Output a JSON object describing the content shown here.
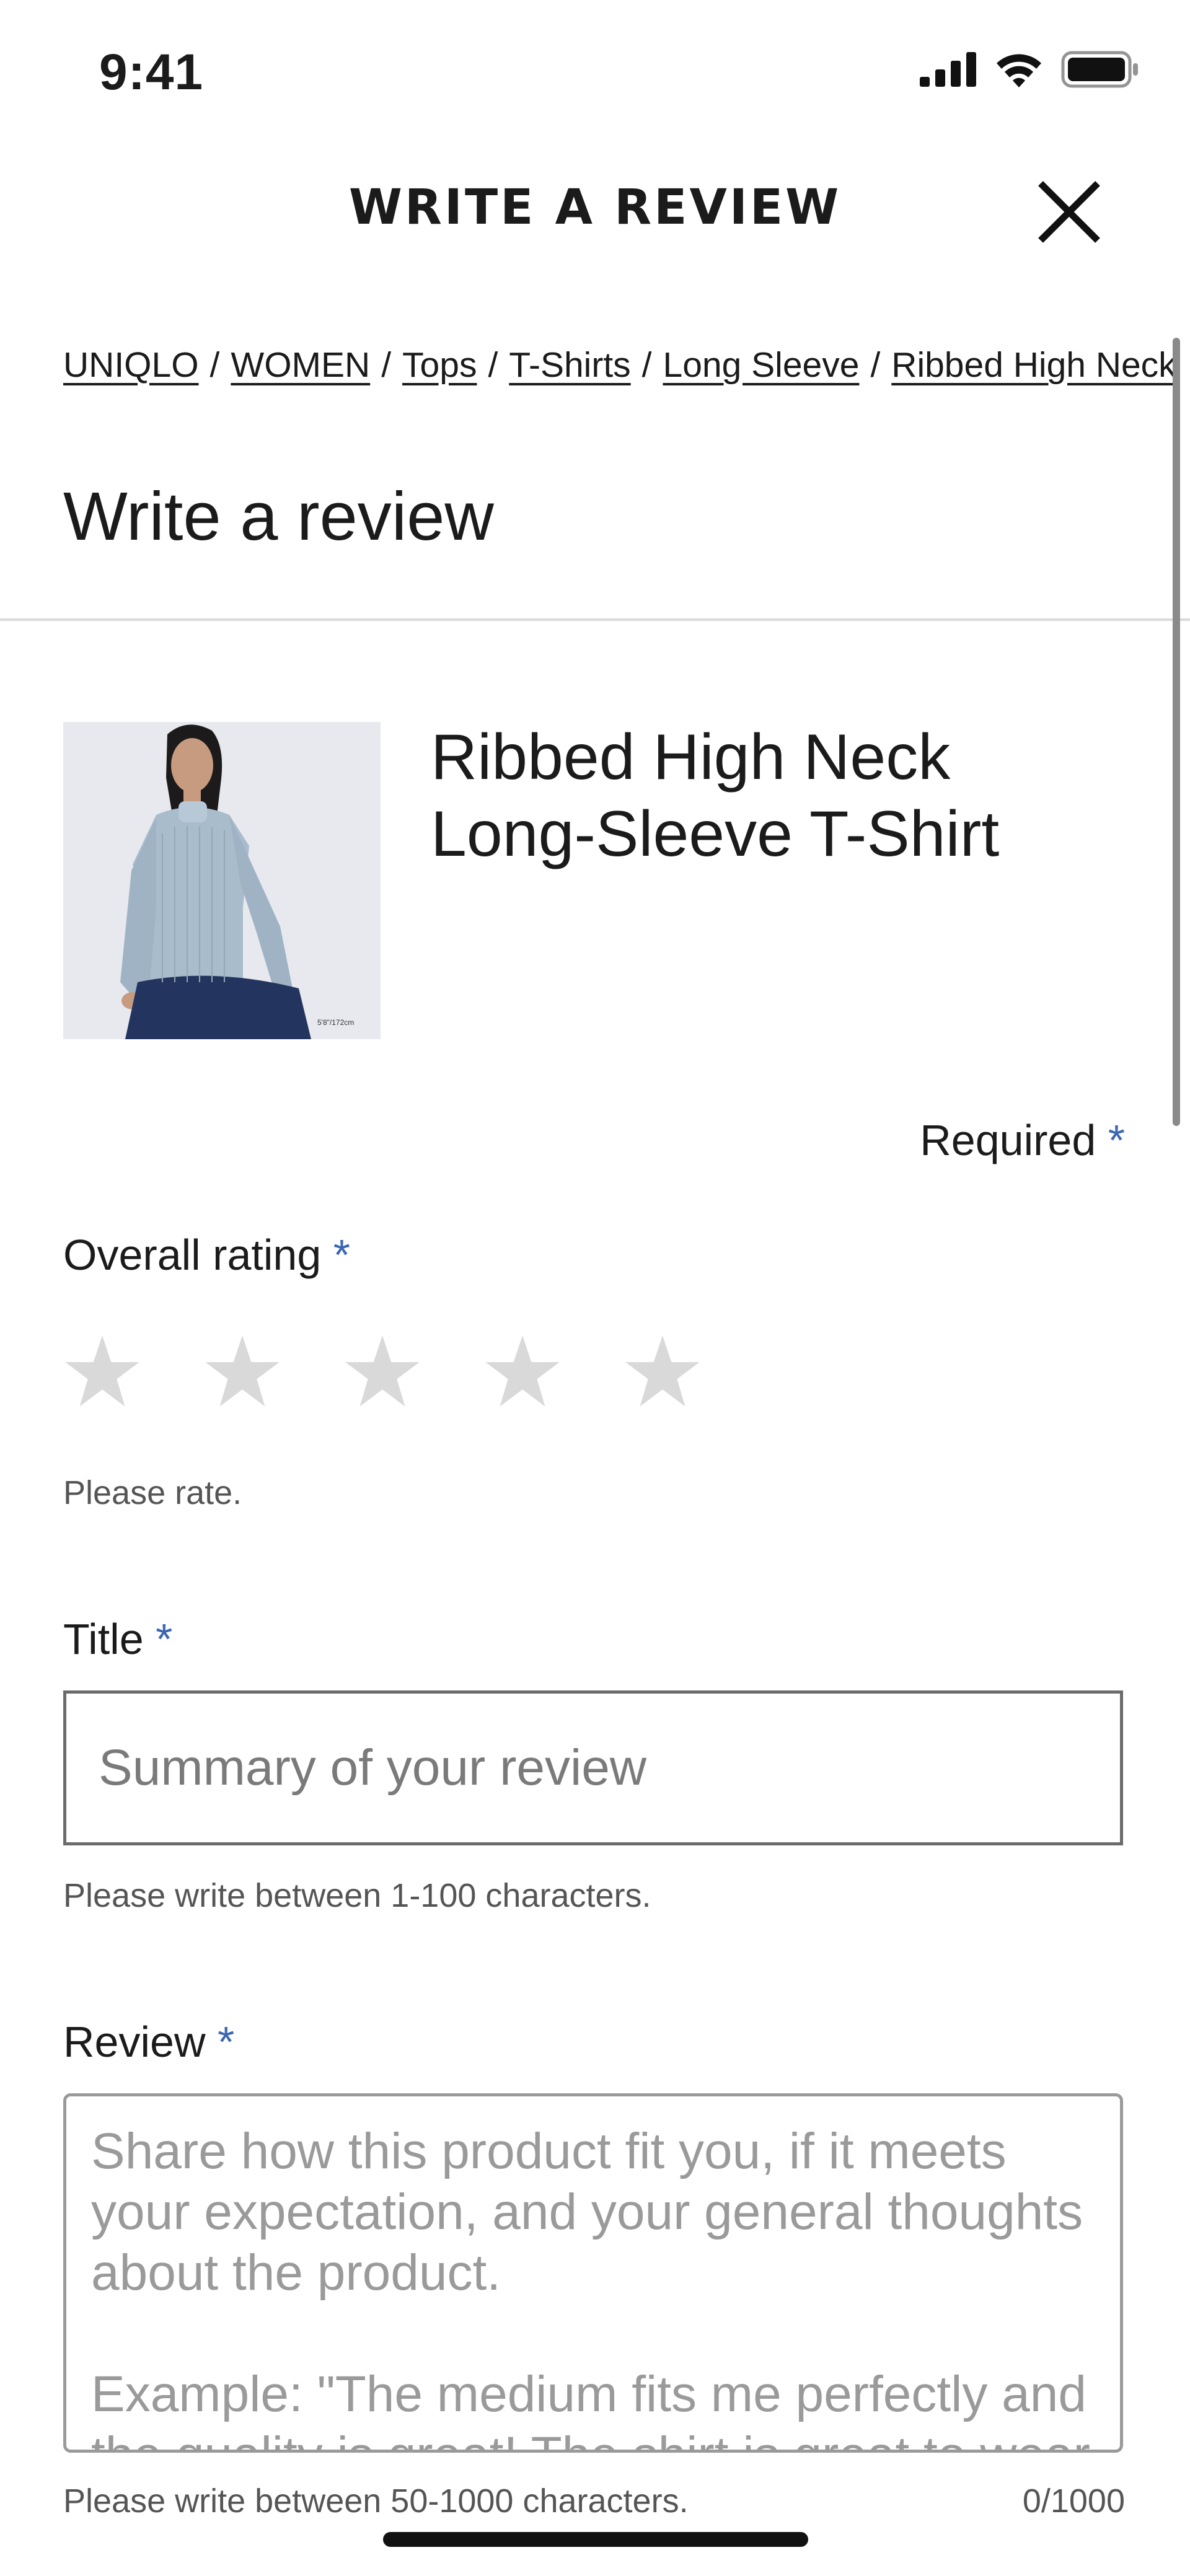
{
  "status_bar": {
    "time": "9:41"
  },
  "header": {
    "title": "WRITE A REVIEW",
    "close_icon": "close-icon"
  },
  "breadcrumb": {
    "items": [
      "UNIQLO",
      "WOMEN",
      "Tops",
      "T-Shirts",
      "Long Sleeve",
      "Ribbed High Neck"
    ],
    "separator": "/"
  },
  "page": {
    "title": "Write a review"
  },
  "product": {
    "name_line1": "Ribbed High Neck",
    "name_line2": "Long-Sleeve T-Shirt",
    "model_info": "5'8\"/172cm"
  },
  "form": {
    "required_label": "Required",
    "required_marker": "*",
    "rating": {
      "label": "Overall rating",
      "hint": "Please rate.",
      "max": 5,
      "value": 0
    },
    "title": {
      "label": "Title",
      "placeholder": "Summary of your review",
      "value": "",
      "hint": "Please write between 1-100 characters."
    },
    "review": {
      "label": "Review",
      "placeholder": "Share how this product fit you, if it meets your expectation, and your general thoughts about the product.\n\nExample: \"The medium fits me perfectly and the quality is great! The shirt is great to wear",
      "value": "",
      "hint": "Please write between 50-1000 characters.",
      "counter": "0/1000"
    }
  },
  "colors": {
    "accent": "#3a66b3",
    "star_empty": "#d9d9d9",
    "text": "#1b1b1b",
    "muted": "#555555"
  }
}
